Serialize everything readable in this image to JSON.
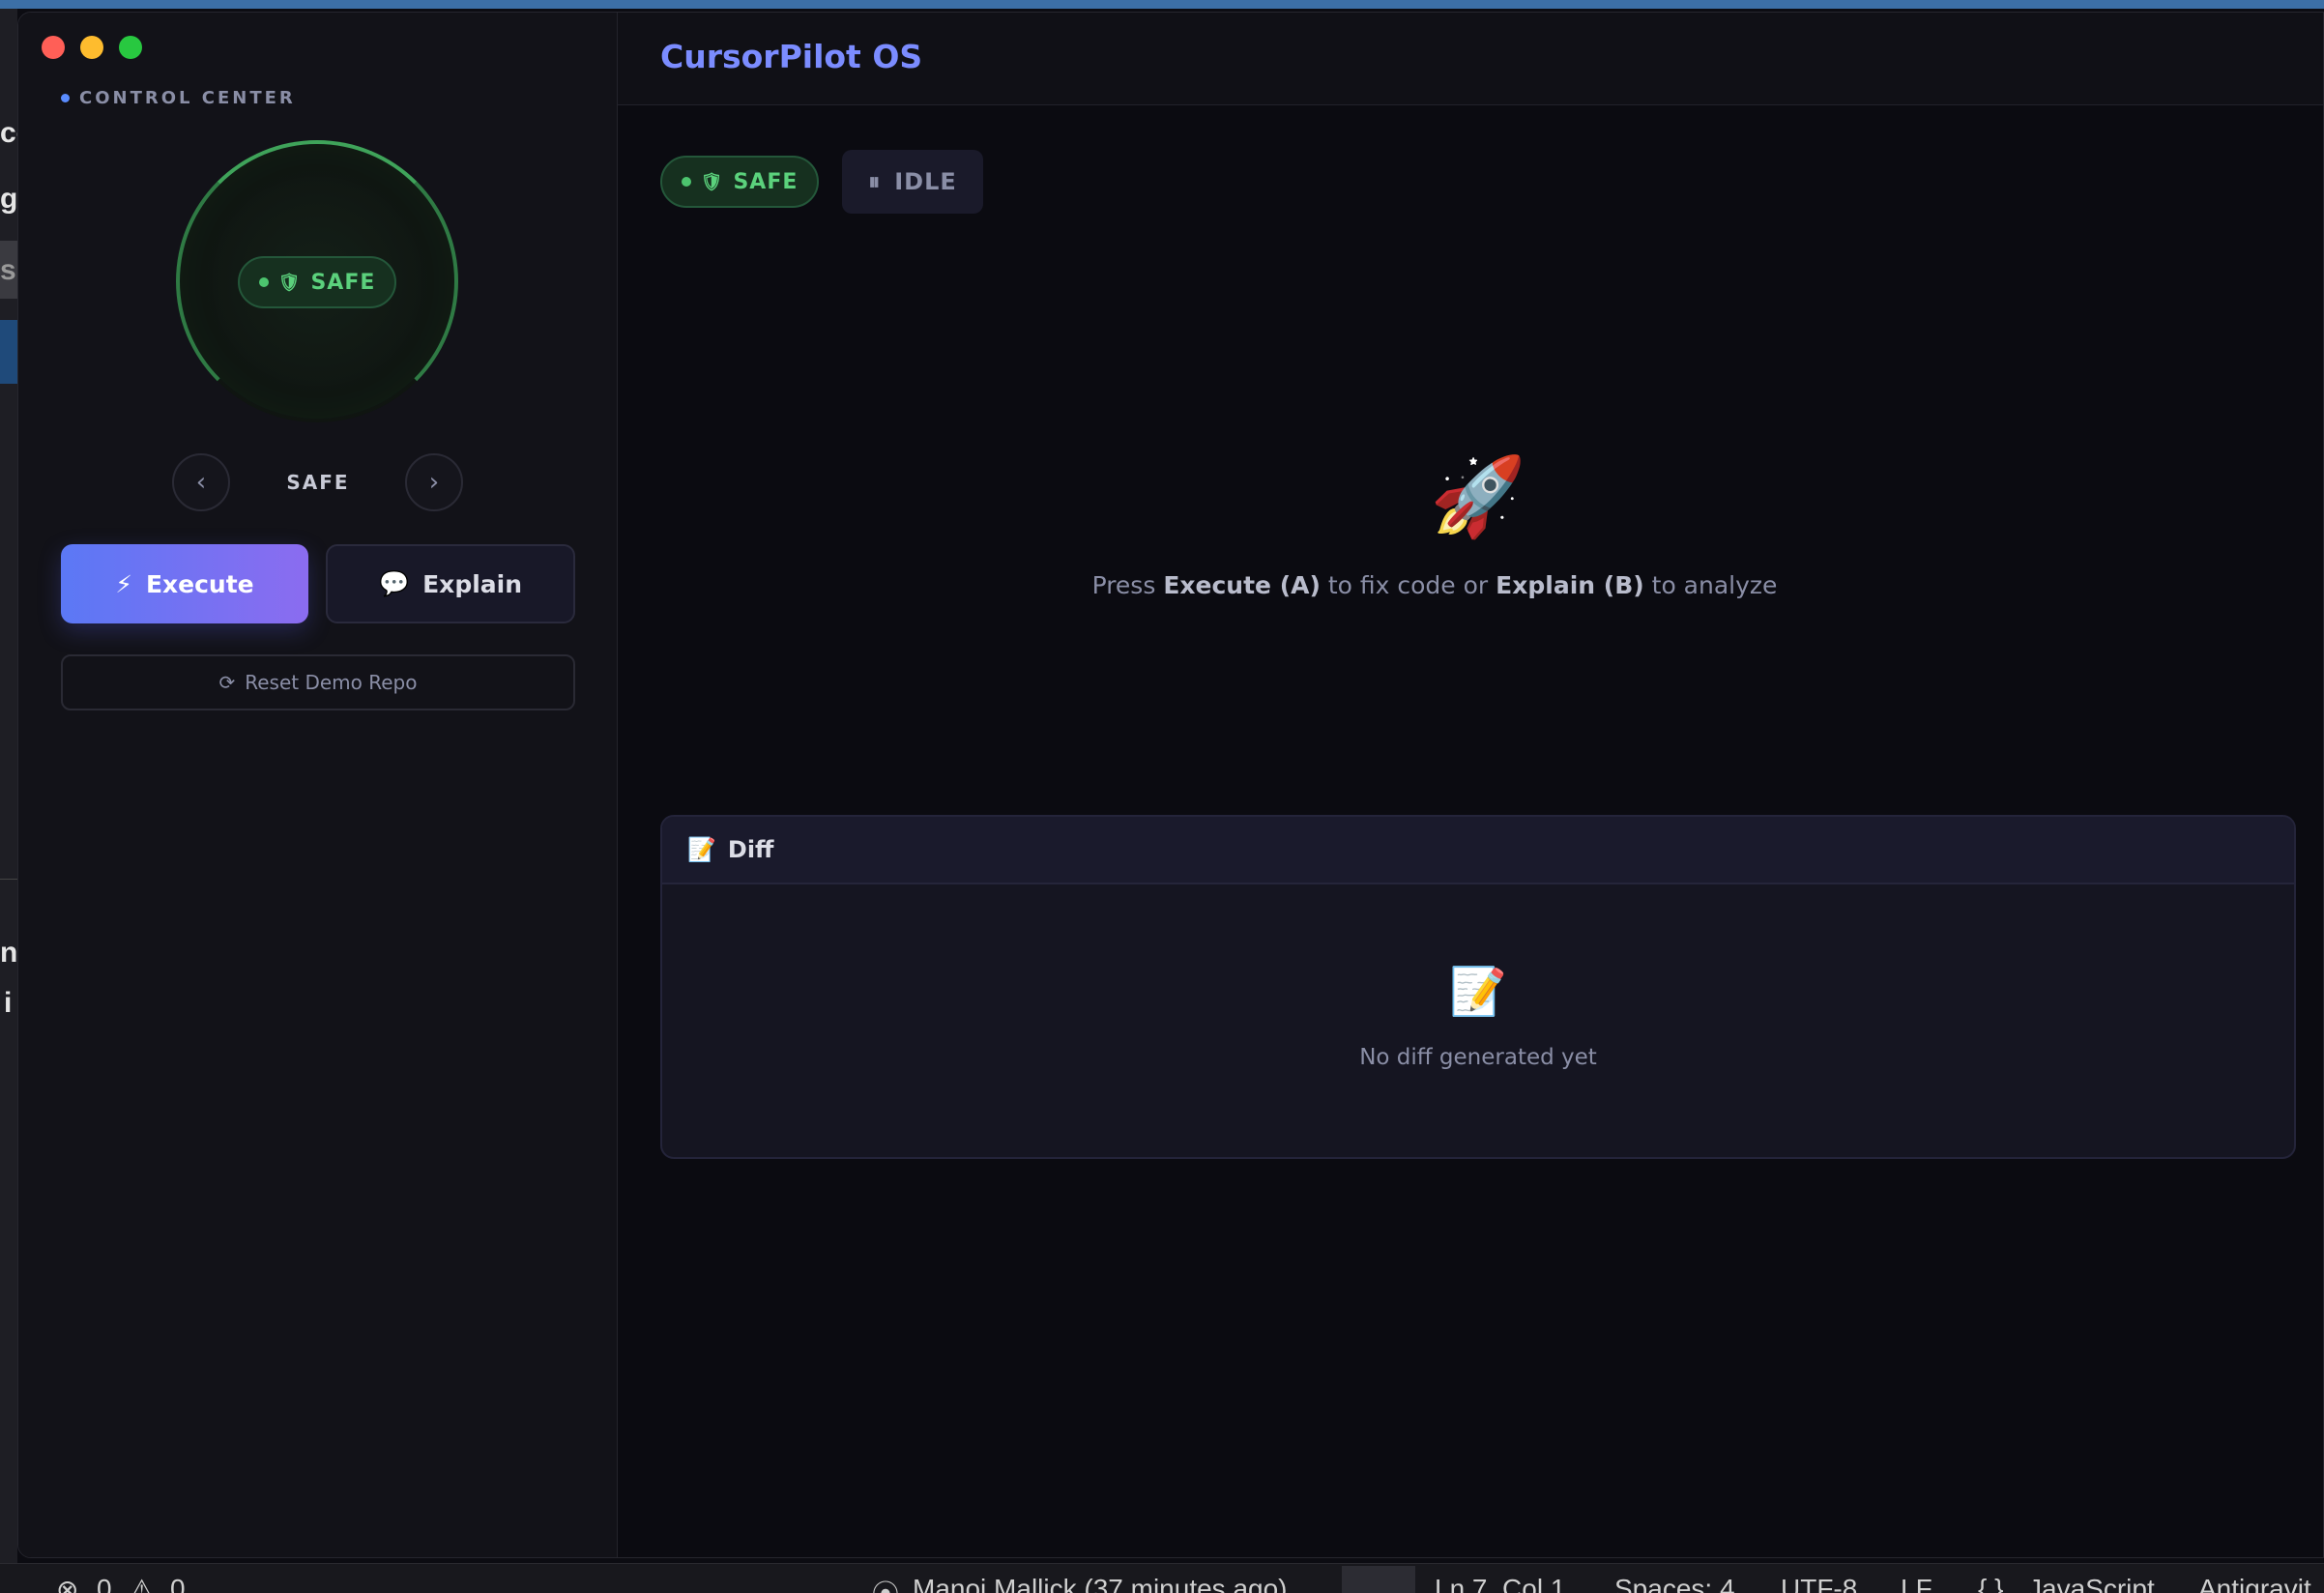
{
  "app": {
    "title": "CursorPilot OS"
  },
  "sidebar": {
    "section_label": "CONTROL CENTER",
    "dial_status": "SAFE",
    "mode_label": "SAFE",
    "prev_glyph": "‹",
    "next_glyph": "›",
    "execute_label": "Execute",
    "execute_icon": "⚡",
    "explain_label": "Explain",
    "explain_icon": "💬",
    "reset_label": "Reset Demo Repo",
    "reset_icon": "⟳"
  },
  "main": {
    "status_pill": "SAFE",
    "state_pill": "IDLE",
    "state_icon": "⏸",
    "rocket_icon": "🚀",
    "hint": {
      "press": "Press",
      "execute": "Execute (A)",
      "middle": "to fix code or",
      "explain": "Explain (B)",
      "end": "to analyze"
    },
    "diff": {
      "icon": "📝",
      "title": "Diff",
      "empty_icon": "📝",
      "empty_text": "No diff generated yet"
    }
  },
  "host": {
    "left_fragments": [
      "ce",
      "g",
      "s",
      "n",
      "i"
    ],
    "statusbar": {
      "errors": "0",
      "warnings": "0",
      "blame": "Manoj Mallick (37 minutes ago)",
      "position": "Ln 7, Col 1",
      "spaces": "Spaces: 4",
      "encoding": "UTF-8",
      "eol": "LF",
      "language": "JavaScript",
      "extension": "Antigravit"
    }
  },
  "colors": {
    "accent": "#7b8cff",
    "safe_green": "#5bd17c",
    "execute_gradient_start": "#5b78f5",
    "execute_gradient_end": "#8b6cf0",
    "traffic_red": "#ff5f57",
    "traffic_yellow": "#febc2e",
    "traffic_green": "#28c840"
  },
  "icons": {
    "shield": "shield-icon",
    "bolt": "bolt-icon",
    "chat": "chat-bubble-icon",
    "reset": "refresh-icon",
    "pause": "pause-icon",
    "rocket": "rocket-icon",
    "memo": "memo-icon"
  }
}
